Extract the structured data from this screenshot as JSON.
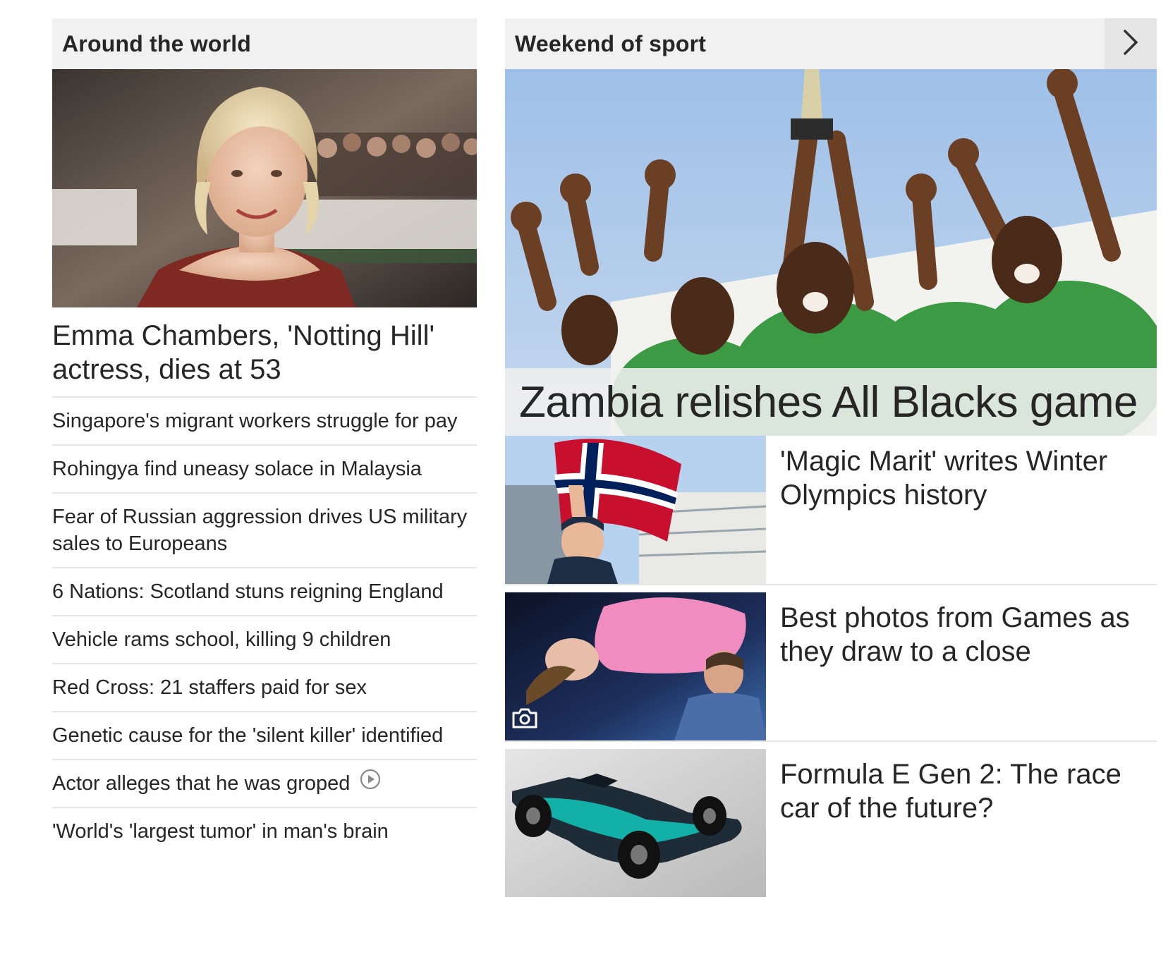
{
  "left_section": {
    "title": "Around the world",
    "lead_headline": "Emma Chambers, 'Notting Hill' actress, dies at 53",
    "headlines": [
      "Singapore's migrant workers struggle for pay",
      "Rohingya find uneasy solace in Malaysia",
      "Fear of Russian aggression drives US military sales to Europeans",
      "6 Nations: Scotland stuns reigning England",
      "Vehicle rams school, killing 9 children",
      "Red Cross: 21 staffers paid for sex",
      "Genetic cause for the 'silent killer' identified",
      "Actor alleges that he was groped",
      "'World's 'largest tumor' in man's brain"
    ],
    "video_icon": "play-circle-icon"
  },
  "right_section": {
    "title": "Weekend of sport",
    "nav_icon": "chevron-right-icon",
    "feature_headline": "Zambia relishes All Blacks game",
    "stories": [
      {
        "headline": "'Magic Marit' writes Winter Olympics history",
        "has_gallery": false
      },
      {
        "headline": "Best photos from Games as they draw to a close",
        "has_gallery": true,
        "gallery_icon": "camera-icon"
      },
      {
        "headline": "Formula E Gen 2: The race car of the future?",
        "has_gallery": false
      }
    ]
  },
  "colors": {
    "header_bg": "#f1f1f1",
    "divider": "#e6e6e6",
    "text": "#262626"
  }
}
